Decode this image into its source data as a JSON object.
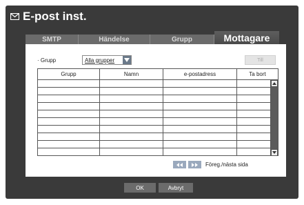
{
  "window": {
    "title": "E-post inst.",
    "icon": "envelope-icon"
  },
  "tabs": [
    {
      "label": "SMTP",
      "active": false
    },
    {
      "label": "Händelse",
      "active": false
    },
    {
      "label": "Grupp",
      "active": false
    },
    {
      "label": "Mottagare",
      "active": true
    }
  ],
  "filter": {
    "label": "· Grupp",
    "selected": "Alla grupper"
  },
  "add_button": {
    "label": "Till",
    "enabled": false
  },
  "table": {
    "columns": [
      "Grupp",
      "Namn",
      "e-postadress",
      "Ta bort"
    ],
    "rows": []
  },
  "pager": {
    "label": "Föreg./nästa sida"
  },
  "footer": {
    "ok_label": "OK",
    "cancel_label": "Avbryt"
  },
  "colors": {
    "frame": "#3a3a3a",
    "tab": "#6b6b6b",
    "pager_button": "#9aa9bd",
    "scrollbar": "#5c5c5c"
  }
}
